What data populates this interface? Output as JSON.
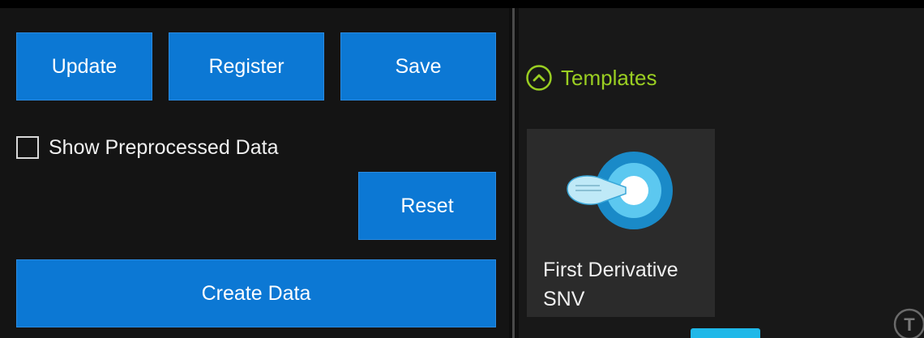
{
  "toolbar": {
    "update_label": "Update",
    "register_label": "Register",
    "save_label": "Save"
  },
  "options": {
    "show_preprocessed_label": "Show Preprocessed Data",
    "show_preprocessed_checked": false
  },
  "reset_label": "Reset",
  "create_data_label": "Create Data",
  "templates": {
    "header_label": "Templates",
    "header_icon": "chevron-up-circle-icon",
    "items": [
      {
        "line1": "First Derivative",
        "line2": "SNV",
        "icon": "target-icon"
      }
    ]
  },
  "corner_badge": "T",
  "colors": {
    "button_blue": "#0c78d4",
    "accent_green": "#9ace22",
    "scroll_indicator": "#20b8e8",
    "target_outer": "#1a8ac8",
    "target_inner": "#5cc8f0"
  }
}
